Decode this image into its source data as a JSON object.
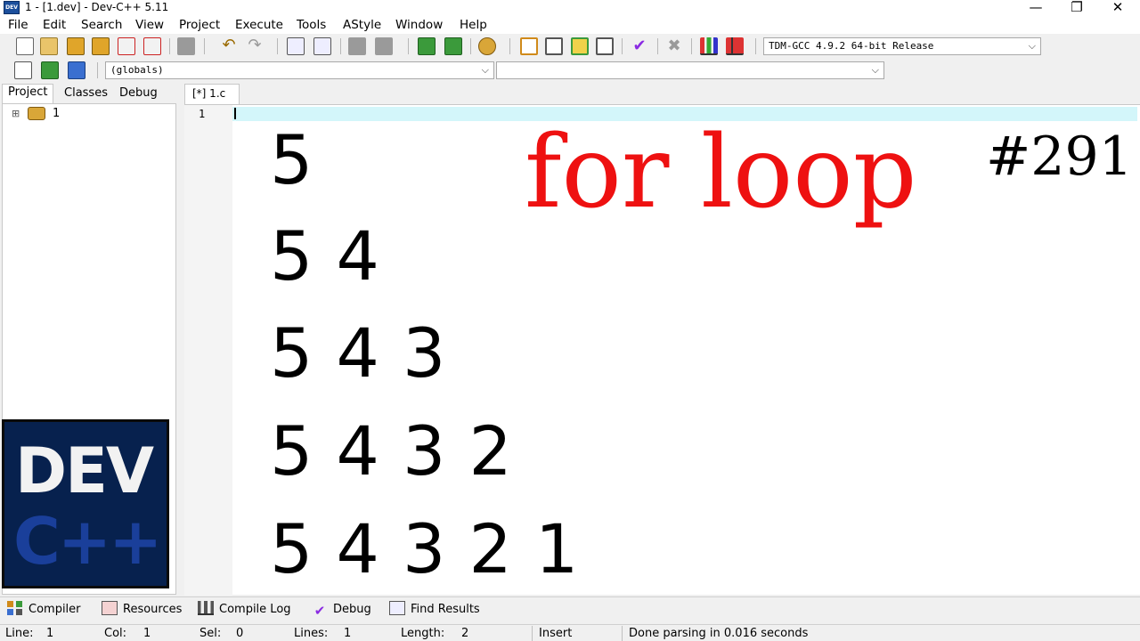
{
  "window": {
    "title": "1 - [1.dev] - Dev-C++ 5.11",
    "app_icon_text": "DEV",
    "controls": [
      "—",
      "❐",
      "✕"
    ]
  },
  "menu": [
    "File",
    "Edit",
    "Search",
    "View",
    "Project",
    "Execute",
    "Tools",
    "AStyle",
    "Window",
    "Help"
  ],
  "toolbar": {
    "compiler_select": "TDM-GCC 4.9.2 64-bit Release",
    "scope_select": "(globals)",
    "member_select": ""
  },
  "left_panel": {
    "tabs": [
      "Project",
      "Classes",
      "Debug"
    ],
    "active_tab": "Project",
    "tree_root_label": "1",
    "tree_expander": "⊞"
  },
  "logo": {
    "line1": "DEV",
    "line2": "C++"
  },
  "editor": {
    "tab_label": "[*] 1.c",
    "line_number": "1",
    "rows": [
      "5",
      "5 4",
      "5 4 3",
      "5 4 3 2",
      "5 4 3 2 1"
    ],
    "title": "for loop",
    "number": "#291"
  },
  "bottom_tabs": [
    "Compiler",
    "Resources",
    "Compile Log",
    "Debug",
    "Find Results"
  ],
  "status": {
    "line_label": "Line:",
    "line_value": "1",
    "col_label": "Col:",
    "col_value": "1",
    "sel_label": "Sel:",
    "sel_value": "0",
    "lines_label": "Lines:",
    "lines_value": "1",
    "length_label": "Length:",
    "length_value": "2",
    "mode": "Insert",
    "message": "Done parsing in 0.016 seconds"
  }
}
